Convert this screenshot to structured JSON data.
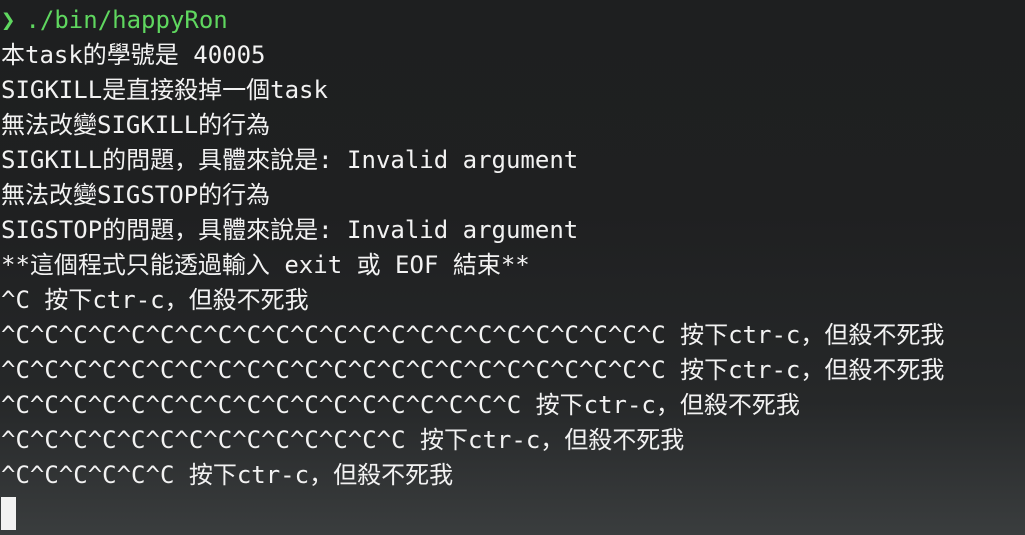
{
  "prompt": {
    "arrow": "❯",
    "command": "./bin/happyRon"
  },
  "output_lines": [
    "本task的學號是 40005",
    "SIGKILL是直接殺掉一個task",
    "無法改變SIGKILL的行為",
    "SIGKILL的問題，具體來說是: Invalid argument",
    "無法改變SIGSTOP的行為",
    "SIGSTOP的問題，具體來說是: Invalid argument",
    "**這個程式只能透過輸入 exit 或 EOF 結束**",
    "^C 按下ctr-c，但殺不死我",
    "^C^C^C^C^C^C^C^C^C^C^C^C^C^C^C^C^C^C^C^C^C^C^C 按下ctr-c，但殺不死我",
    "^C^C^C^C^C^C^C^C^C^C^C^C^C^C^C^C^C^C^C^C^C^C^C 按下ctr-c，但殺不死我",
    "^C^C^C^C^C^C^C^C^C^C^C^C^C^C^C^C^C^C 按下ctr-c，但殺不死我",
    "^C^C^C^C^C^C^C^C^C^C^C^C^C^C 按下ctr-c，但殺不死我",
    "^C^C^C^C^C^C 按下ctr-c，但殺不死我"
  ]
}
